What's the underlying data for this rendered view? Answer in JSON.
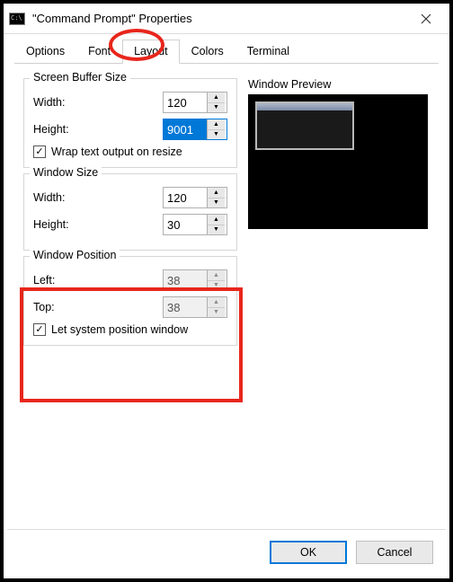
{
  "window": {
    "title": "\"Command Prompt\" Properties",
    "icon": "cmd-icon"
  },
  "tabs": {
    "options": "Options",
    "font": "Font",
    "layout": "Layout",
    "colors": "Colors",
    "terminal": "Terminal",
    "active": "layout"
  },
  "screenBuffer": {
    "title": "Screen Buffer Size",
    "widthLabel": "Width:",
    "widthValue": "120",
    "heightLabel": "Height:",
    "heightValue": "9001",
    "wrapLabel": "Wrap text output on resize",
    "wrapChecked": true
  },
  "windowSize": {
    "title": "Window Size",
    "widthLabel": "Width:",
    "widthValue": "120",
    "heightLabel": "Height:",
    "heightValue": "30"
  },
  "windowPosition": {
    "title": "Window Position",
    "leftLabel": "Left:",
    "leftValue": "38",
    "topLabel": "Top:",
    "topValue": "38",
    "letSystemLabel": "Let system position window",
    "letSystemChecked": true
  },
  "preview": {
    "label": "Window Preview"
  },
  "footer": {
    "ok": "OK",
    "cancel": "Cancel"
  },
  "annotations": {
    "circleTab": "layout-tab-highlight",
    "rectGroup": "window-position-highlight"
  }
}
